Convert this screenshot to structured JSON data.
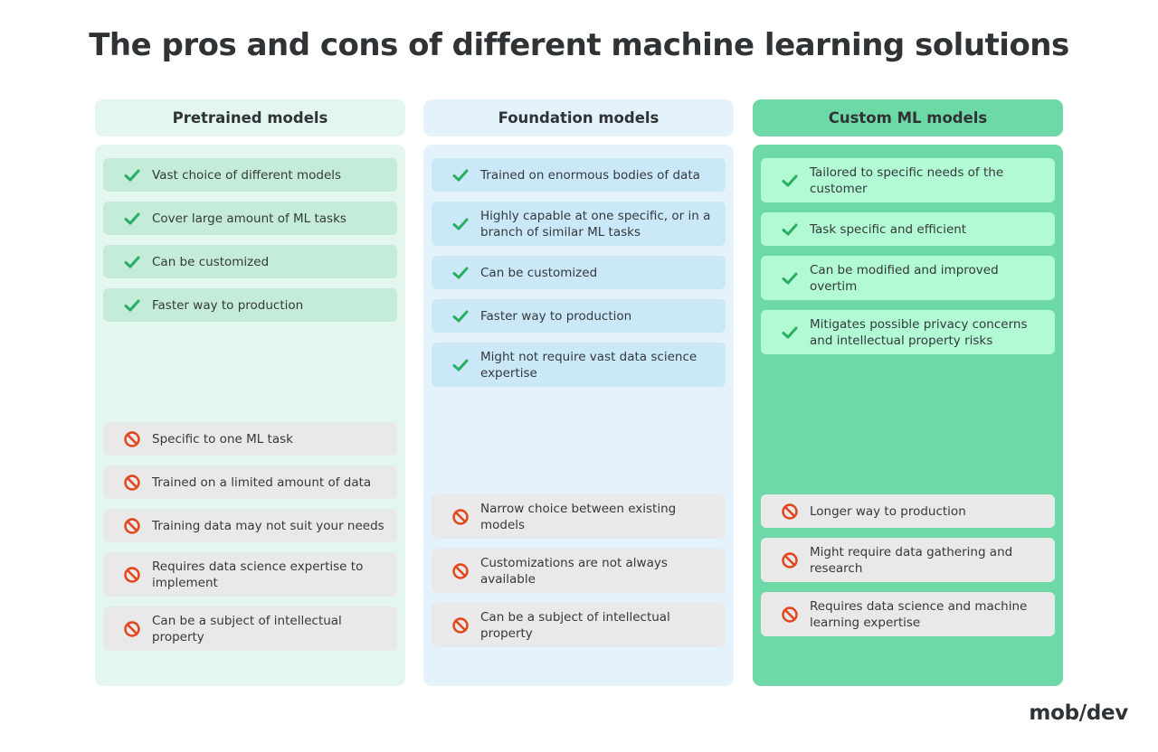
{
  "title": "The pros and cons of different machine learning solutions",
  "columns": [
    {
      "header": "Pretrained models",
      "pros": [
        "Vast choice of different models",
        "Cover large amount of ML tasks",
        "Can be customized",
        "Faster way to production"
      ],
      "cons": [
        "Specific to one ML task",
        "Trained on a limited amount of data",
        "Training data may not suit your needs",
        "Requires data science expertise to implement",
        "Can be a subject of intellectual property"
      ]
    },
    {
      "header": "Foundation models",
      "pros": [
        "Trained on enormous bodies of data",
        "Highly capable at one specific, or in a branch of similar ML tasks",
        "Can be customized",
        "Faster way to production",
        "Might not require vast data science expertise"
      ],
      "cons": [
        "Narrow choice between existing models",
        "Customizations are not always available",
        "Can be a subject of intellectual property"
      ]
    },
    {
      "header": "Custom ML models",
      "pros": [
        "Tailored to specific needs of the customer",
        "Task specific and efficient",
        "Can be modified and improved overtim",
        "Mitigates possible privacy concerns and intellectual property risks"
      ],
      "cons": [
        "Longer way to production",
        "Might require data gathering and research",
        "Requires data science and machine learning expertise"
      ]
    }
  ],
  "icons": {
    "pro": "check-icon",
    "con": "prohibited-icon"
  },
  "colors": {
    "check": "#27ae60",
    "prohibited": "#e2471f",
    "text": "#2f3336"
  },
  "logo": "mob/dev"
}
